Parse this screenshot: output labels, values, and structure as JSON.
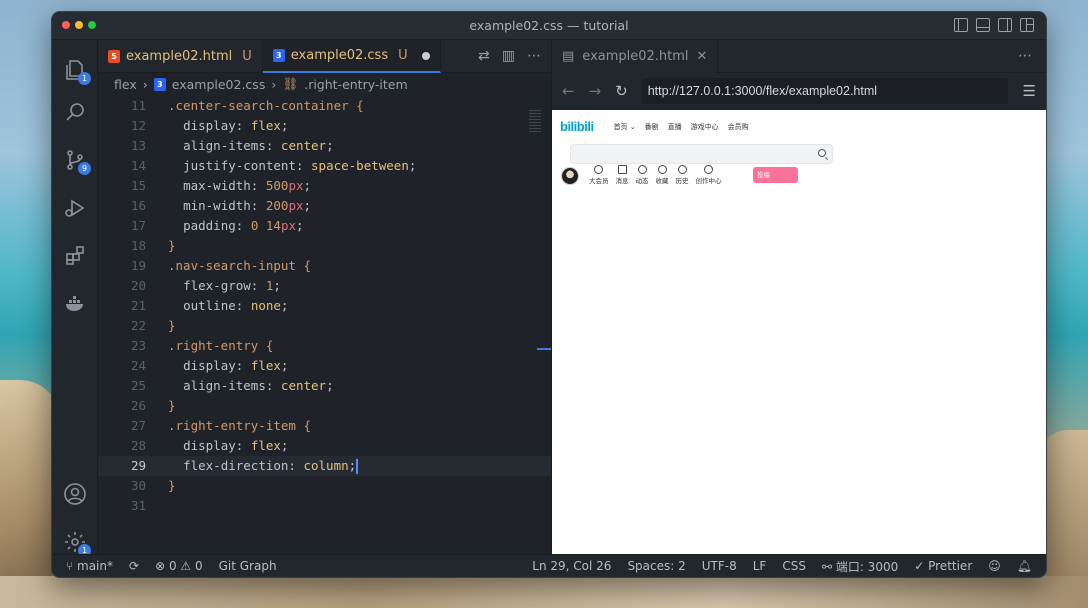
{
  "window": {
    "title": "example02.css — tutorial"
  },
  "activity": {
    "explorer_badge": "1",
    "scm_badge": "9",
    "settings_badge": "1"
  },
  "editor": {
    "tabs": [
      {
        "name": "example02.html",
        "status": "U"
      },
      {
        "name": "example02.css",
        "status": "U"
      }
    ],
    "breadcrumb": [
      "flex",
      "example02.css",
      ".right-entry-item"
    ],
    "lines": [
      {
        "n": "11",
        "html": "<span class='sel'>.center-search-container</span> <span class='brace'>{</span>"
      },
      {
        "n": "12",
        "html": "  <span class='prop'>display</span><span class='punc'>:</span> <span class='val'>flex</span><span class='punc'>;</span>"
      },
      {
        "n": "13",
        "html": "  <span class='prop'>align-items</span><span class='punc'>:</span> <span class='val'>center</span><span class='punc'>;</span>"
      },
      {
        "n": "14",
        "html": "  <span class='prop'>justify-content</span><span class='punc'>:</span> <span class='val'>space-between</span><span class='punc'>;</span>"
      },
      {
        "n": "15",
        "html": "  <span class='prop'>max-width</span><span class='punc'>:</span> <span class='num'>500</span><span class='unit'>px</span><span class='punc'>;</span>"
      },
      {
        "n": "16",
        "html": "  <span class='prop'>min-width</span><span class='punc'>:</span> <span class='num'>200</span><span class='unit'>px</span><span class='punc'>;</span>"
      },
      {
        "n": "17",
        "html": "  <span class='prop'>padding</span><span class='punc'>:</span> <span class='num'>0</span> <span class='num'>14</span><span class='unit'>px</span><span class='punc'>;</span>"
      },
      {
        "n": "18",
        "html": "<span class='brace'>}</span>"
      },
      {
        "n": "19",
        "html": "<span class='sel'>.nav-search-input</span> <span class='brace'>{</span>"
      },
      {
        "n": "20",
        "html": "  <span class='prop'>flex-grow</span><span class='punc'>:</span> <span class='num'>1</span><span class='punc'>;</span>"
      },
      {
        "n": "21",
        "html": "  <span class='prop'>outline</span><span class='punc'>:</span> <span class='val'>none</span><span class='punc'>;</span>"
      },
      {
        "n": "22",
        "html": "<span class='brace'>}</span>"
      },
      {
        "n": "23",
        "html": "<span class='sel'>.right-entry</span> <span class='brace'>{</span>"
      },
      {
        "n": "24",
        "html": "  <span class='prop'>display</span><span class='punc'>:</span> <span class='val'>flex</span><span class='punc'>;</span>"
      },
      {
        "n": "25",
        "html": "  <span class='prop'>align-items</span><span class='punc'>:</span> <span class='val'>center</span><span class='punc'>;</span>"
      },
      {
        "n": "26",
        "html": "<span class='brace'>}</span>"
      },
      {
        "n": "27",
        "html": "<span class='sel'>.right-entry-item</span> <span class='brace'>{</span>"
      },
      {
        "n": "28",
        "html": "  <span class='prop'>display</span><span class='punc'>:</span> <span class='val'>flex</span><span class='punc'>;</span>"
      },
      {
        "n": "29",
        "html": "  <span class='prop'>flex-direction</span><span class='punc'>:</span> <span class='val'>column</span><span class='punc'>;</span><span class='cursor'></span>",
        "current": true
      },
      {
        "n": "30",
        "html": "<span class='brace'>}</span>"
      },
      {
        "n": "31",
        "html": ""
      }
    ]
  },
  "browser": {
    "tab_title": "example02.html",
    "url": "http://127.0.0.1:3000/flex/example02.html",
    "page": {
      "logo": "bilibili",
      "nav": [
        "首页 ⌄",
        "番剧",
        "直播",
        "游戏中心",
        "会员购"
      ],
      "items": [
        "大会员",
        "消息",
        "动态",
        "收藏",
        "历史",
        "创作中心"
      ],
      "upload": "投稿"
    }
  },
  "status": {
    "branch": "main*",
    "problems_errors": "0",
    "problems_warnings": "0",
    "git_graph": "Git Graph",
    "cursor": "Ln 29, Col 26",
    "spaces": "Spaces: 2",
    "encoding": "UTF-8",
    "eol": "LF",
    "language": "CSS",
    "port": "端口: 3000",
    "prettier": "Prettier"
  }
}
